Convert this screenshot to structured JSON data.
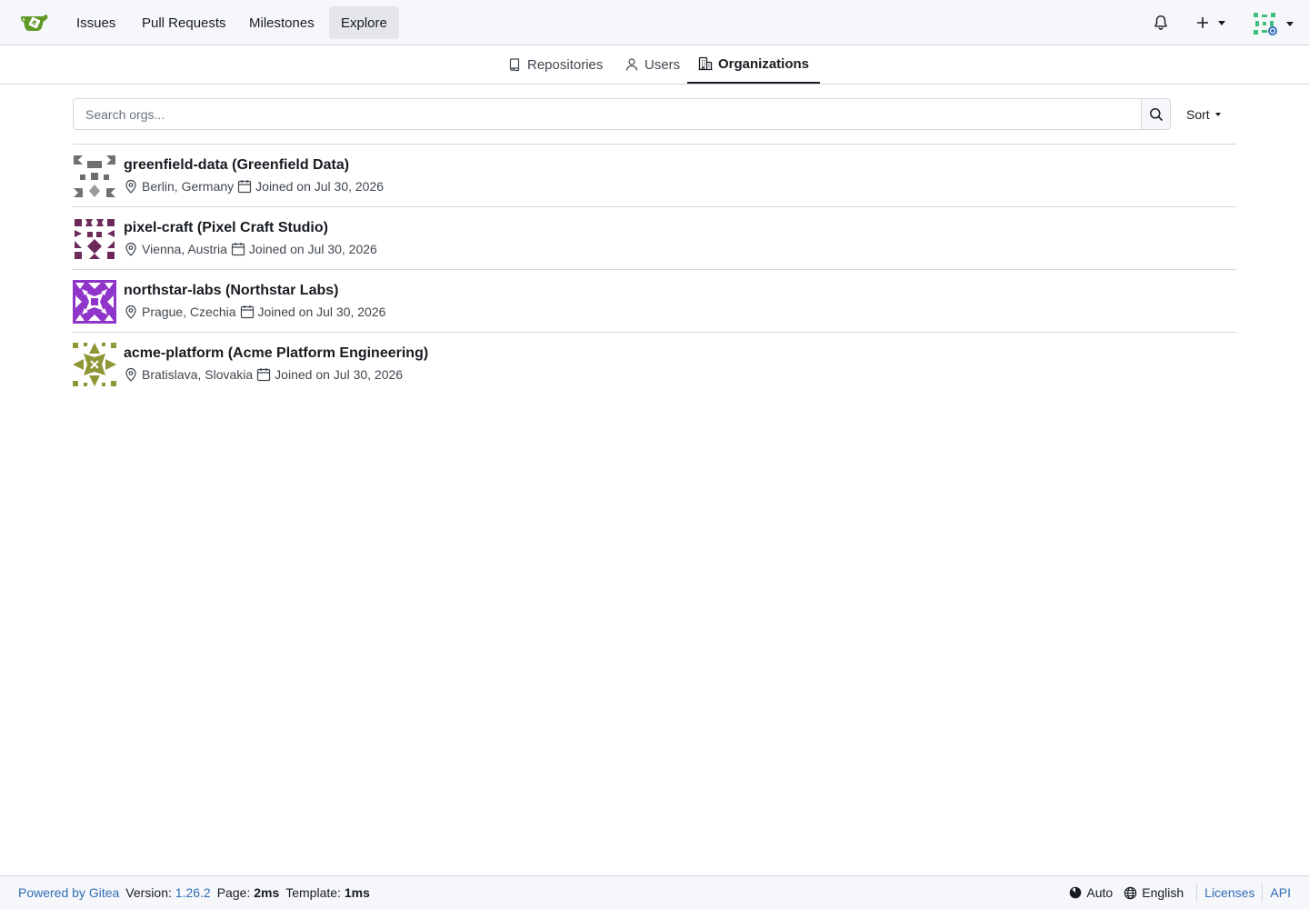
{
  "navbar": {
    "items": [
      {
        "label": "Issues"
      },
      {
        "label": "Pull Requests"
      },
      {
        "label": "Milestones"
      },
      {
        "label": "Explore"
      }
    ],
    "icons": [
      "gitea-logo-icon",
      "bell-icon",
      "plus-icon",
      "avatar"
    ]
  },
  "tabs": [
    {
      "label": "Repositories",
      "icon": "repo-icon"
    },
    {
      "label": "Users",
      "icon": "person-icon"
    },
    {
      "label": "Organizations",
      "icon": "organization-icon"
    }
  ],
  "search": {
    "placeholder": "Search orgs...",
    "value": ""
  },
  "sort": {
    "label": "Sort"
  },
  "orgs": [
    {
      "name": "greenfield-data (Greenfield Data)",
      "location": "Berlin, Germany",
      "joined": "Joined on Jul 30, 2026",
      "avatar_color": "#6e6e6e"
    },
    {
      "name": "pixel-craft (Pixel Craft Studio)",
      "location": "Vienna, Austria",
      "joined": "Joined on Jul 30, 2026",
      "avatar_color": "#6b2a5a"
    },
    {
      "name": "northstar-labs (Northstar Labs)",
      "location": "Prague, Czechia",
      "joined": "Joined on Jul 30, 2026",
      "avatar_color": "#8f35c9"
    },
    {
      "name": "acme-platform (Acme Platform Engineering)",
      "location": "Bratislava, Slovakia",
      "joined": "Joined on Jul 30, 2026",
      "avatar_color": "#8f9636"
    }
  ],
  "footer": {
    "powered": "Powered by Gitea",
    "version_label": "Version:",
    "version": "1.26.2",
    "page_label": "Page:",
    "page_time": "2ms",
    "template_label": "Template:",
    "template_time": "1ms",
    "theme": "Auto",
    "language": "English",
    "licenses": "Licenses",
    "api": "API"
  },
  "colors": {
    "accent_link": "#2f6db6",
    "logo_green": "#609926"
  }
}
